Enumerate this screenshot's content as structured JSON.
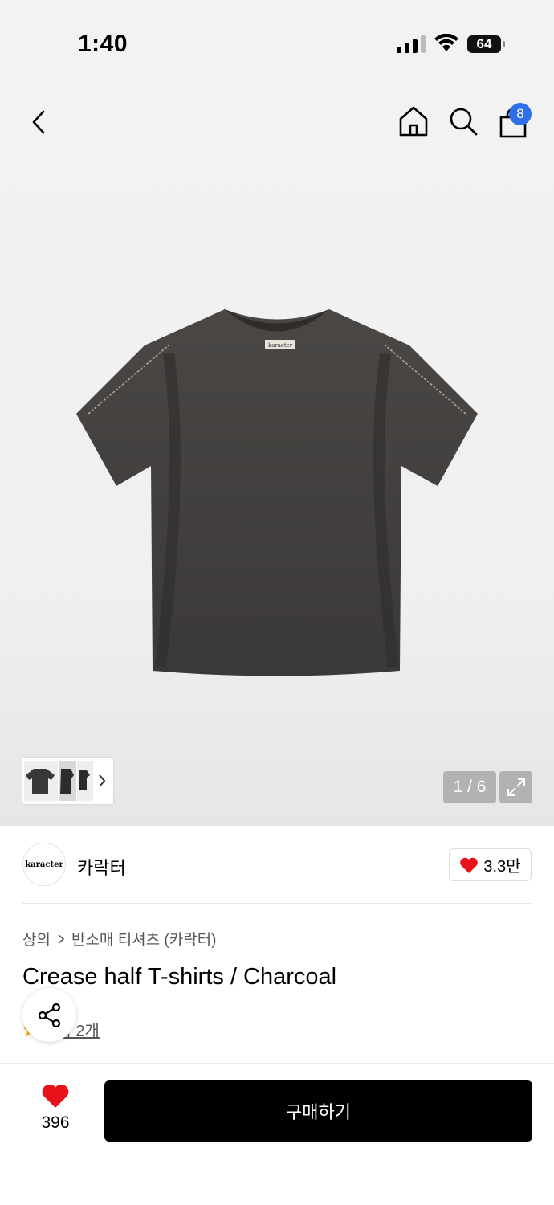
{
  "status_bar": {
    "time": "1:40",
    "battery": "64"
  },
  "header": {
    "cart_count": "8"
  },
  "gallery": {
    "counter": "1 / 6"
  },
  "brand": {
    "logo_text": "karacter",
    "name": "카락터",
    "likes": "3.3만"
  },
  "product": {
    "breadcrumb": [
      "상의",
      "반소매 티셔츠 (카락터)"
    ],
    "title": "Crease half T-shirts / Charcoal",
    "review_text": "후기 2개",
    "tag_text": "karacter"
  },
  "bottom_bar": {
    "wish_count": "396",
    "buy_label": "구매하기"
  },
  "colors": {
    "accent_badge": "#2f6fe8",
    "heart": "#e8121a",
    "buy_button": "#000000"
  }
}
